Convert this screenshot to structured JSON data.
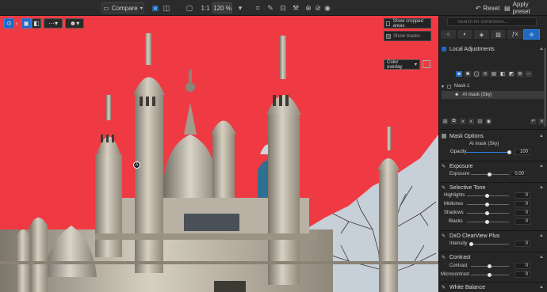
{
  "toolbar": {
    "compare_label": "Compare",
    "zoom_ratio": "1:1",
    "zoom_percent": "120 %",
    "reset_label": "Reset",
    "apply_preset_label": "Apply preset"
  },
  "viewer": {
    "show_cropped_areas": "Show cropped areas",
    "show_masks": "Show masks",
    "overlay_mode": "Color overlay",
    "overlay_color": "#ef3a43",
    "cursor_letter": "A"
  },
  "panel": {
    "search_placeholder": "Search for corrections...",
    "local_adjustments": "Local Adjustments",
    "mask_group": "Mask 1",
    "mask_item": "AI mask (Sky)",
    "mask_options": "Mask Options",
    "mask_name": "AI mask (Sky)",
    "opacity_label": "Opacity",
    "opacity_value": "100",
    "exposure_title": "Exposure",
    "exposure_label": "Exposure",
    "exposure_value": "0.00",
    "selective_tone_title": "Selective Tone",
    "highlights_label": "Highlights",
    "highlights_value": "0",
    "midtones_label": "Midtones",
    "midtones_value": "0",
    "shadows_label": "Shadows",
    "shadows_value": "0",
    "blacks_label": "Blacks",
    "blacks_value": "0",
    "clearview_title": "DxO ClearView Plus",
    "intensity_label": "Intensity",
    "intensity_value": "0",
    "contrast_title": "Contrast",
    "contrast_label": "Contrast",
    "contrast_value": "0",
    "microcontrast_label": "Microcontrast",
    "microcontrast_value": "0",
    "white_balance_title": "White Balance"
  },
  "colors": {
    "accent": "#1e68c4",
    "mask": "#ef3a43"
  }
}
